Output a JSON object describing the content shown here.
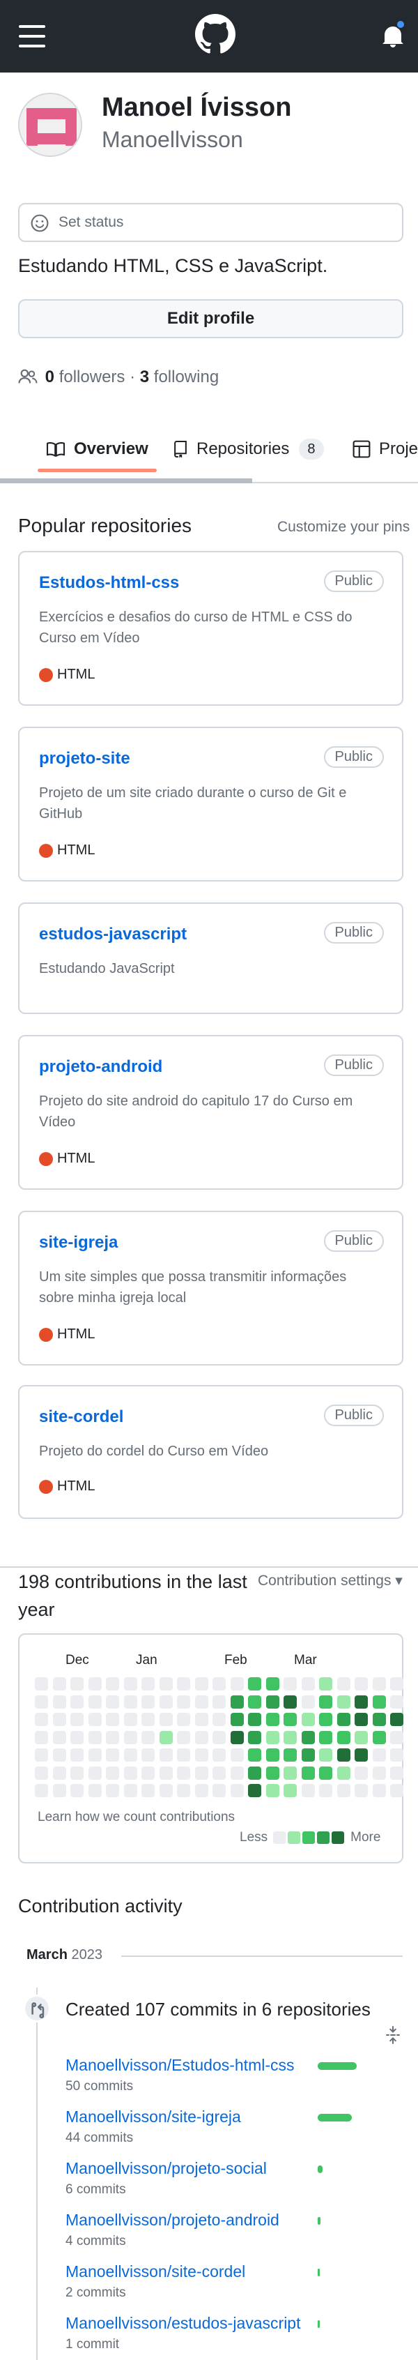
{
  "topbar": {
    "menu_icon": "hamburger-icon",
    "logo_icon": "github-mark-icon",
    "notifications_icon": "bell-icon"
  },
  "profile": {
    "name": "Manoel Ívisson",
    "login": "Manoellvisson",
    "status_placeholder": "Set status",
    "bio": "Estudando HTML, CSS e JavaScript.",
    "edit_profile_label": "Edit profile",
    "followers_count": "0",
    "followers_label": "followers",
    "separator": "·",
    "following_count": "3",
    "following_label": "following"
  },
  "tabs": [
    {
      "label": "Overview",
      "icon": "book-icon",
      "active": true
    },
    {
      "label": "Repositories",
      "icon": "repo-icon",
      "count": "8"
    },
    {
      "label": "Projects",
      "icon": "table-icon"
    }
  ],
  "popular": {
    "title": "Popular repositories",
    "customize_label": "Customize your pins",
    "repos": [
      {
        "name": "Estudos-html-css",
        "visibility": "Public",
        "description": "Exercícios e desafios do curso de HTML e CSS do Curso em Vídeo",
        "language": "HTML"
      },
      {
        "name": "projeto-site",
        "visibility": "Public",
        "description": "Projeto de um site criado durante o curso de Git e GitHub",
        "language": "HTML"
      },
      {
        "name": "estudos-javascript",
        "visibility": "Public",
        "description": "Estudando JavaScript",
        "language": ""
      },
      {
        "name": "projeto-android",
        "visibility": "Public",
        "description": "Projeto do site android do capitulo 17 do Curso em Vídeo",
        "language": "HTML"
      },
      {
        "name": "site-igreja",
        "visibility": "Public",
        "description": "Um site simples que possa transmitir informações sobre minha igreja local",
        "language": "HTML"
      },
      {
        "name": "site-cordel",
        "visibility": "Public",
        "description": "Projeto do cordel do Curso em Vídeo",
        "language": "HTML"
      }
    ],
    "language_color": "#e34c26"
  },
  "contributions": {
    "title": "198 contributions in the last year",
    "settings_label": "Contribution settings ▾",
    "months": [
      "Dec",
      "Jan",
      "Feb",
      "Mar"
    ],
    "learn_label": "Learn how we count contributions",
    "legend_less": "Less",
    "legend_more": "More",
    "colors": [
      "#ebedf0",
      "#9be9a8",
      "#40c463",
      "#30a14e",
      "#216e39"
    ],
    "weeks": [
      [
        0,
        0,
        0,
        0,
        0,
        0,
        0
      ],
      [
        0,
        0,
        0,
        0,
        0,
        0,
        0
      ],
      [
        0,
        0,
        0,
        0,
        0,
        0,
        0
      ],
      [
        0,
        0,
        0,
        0,
        0,
        0,
        0
      ],
      [
        0,
        0,
        0,
        0,
        0,
        0,
        0
      ],
      [
        0,
        0,
        0,
        0,
        0,
        0,
        0
      ],
      [
        0,
        0,
        0,
        0,
        0,
        0,
        0
      ],
      [
        0,
        0,
        0,
        1,
        0,
        0,
        0
      ],
      [
        0,
        0,
        0,
        0,
        0,
        0,
        0
      ],
      [
        0,
        0,
        0,
        0,
        0,
        0,
        0
      ],
      [
        0,
        0,
        0,
        0,
        0,
        0,
        0
      ],
      [
        0,
        3,
        3,
        4,
        0,
        0,
        0
      ],
      [
        2,
        2,
        3,
        3,
        2,
        3,
        4
      ],
      [
        2,
        3,
        2,
        1,
        2,
        2,
        1
      ],
      [
        0,
        4,
        2,
        1,
        2,
        1,
        1
      ],
      [
        0,
        0,
        1,
        3,
        3,
        2,
        0
      ],
      [
        1,
        2,
        2,
        2,
        1,
        2,
        0
      ],
      [
        0,
        1,
        3,
        2,
        4,
        1,
        0
      ],
      [
        0,
        4,
        4,
        1,
        4,
        0,
        0
      ],
      [
        0,
        2,
        3,
        2,
        0,
        0,
        0
      ],
      [
        0,
        0,
        4,
        0,
        0,
        0,
        0
      ]
    ]
  },
  "activity": {
    "title": "Contribution activity",
    "month_name": "March",
    "year": "2023",
    "summary": "Created 107 commits in 6 repositories",
    "repos": [
      {
        "name": "Manoellvisson/Estudos-html-css",
        "commits": "50 commits",
        "bar_fraction": 1.0
      },
      {
        "name": "Manoellvisson/site-igreja",
        "commits": "44 commits",
        "bar_fraction": 0.88
      },
      {
        "name": "Manoellvisson/projeto-social",
        "commits": "6 commits",
        "bar_fraction": 0.12
      },
      {
        "name": "Manoellvisson/projeto-android",
        "commits": "4 commits",
        "bar_fraction": 0.08
      },
      {
        "name": "Manoellvisson/site-cordel",
        "commits": "2 commits",
        "bar_fraction": 0.04
      },
      {
        "name": "Manoellvisson/estudos-javascript",
        "commits": "1 commit",
        "bar_fraction": 0.02
      }
    ]
  }
}
